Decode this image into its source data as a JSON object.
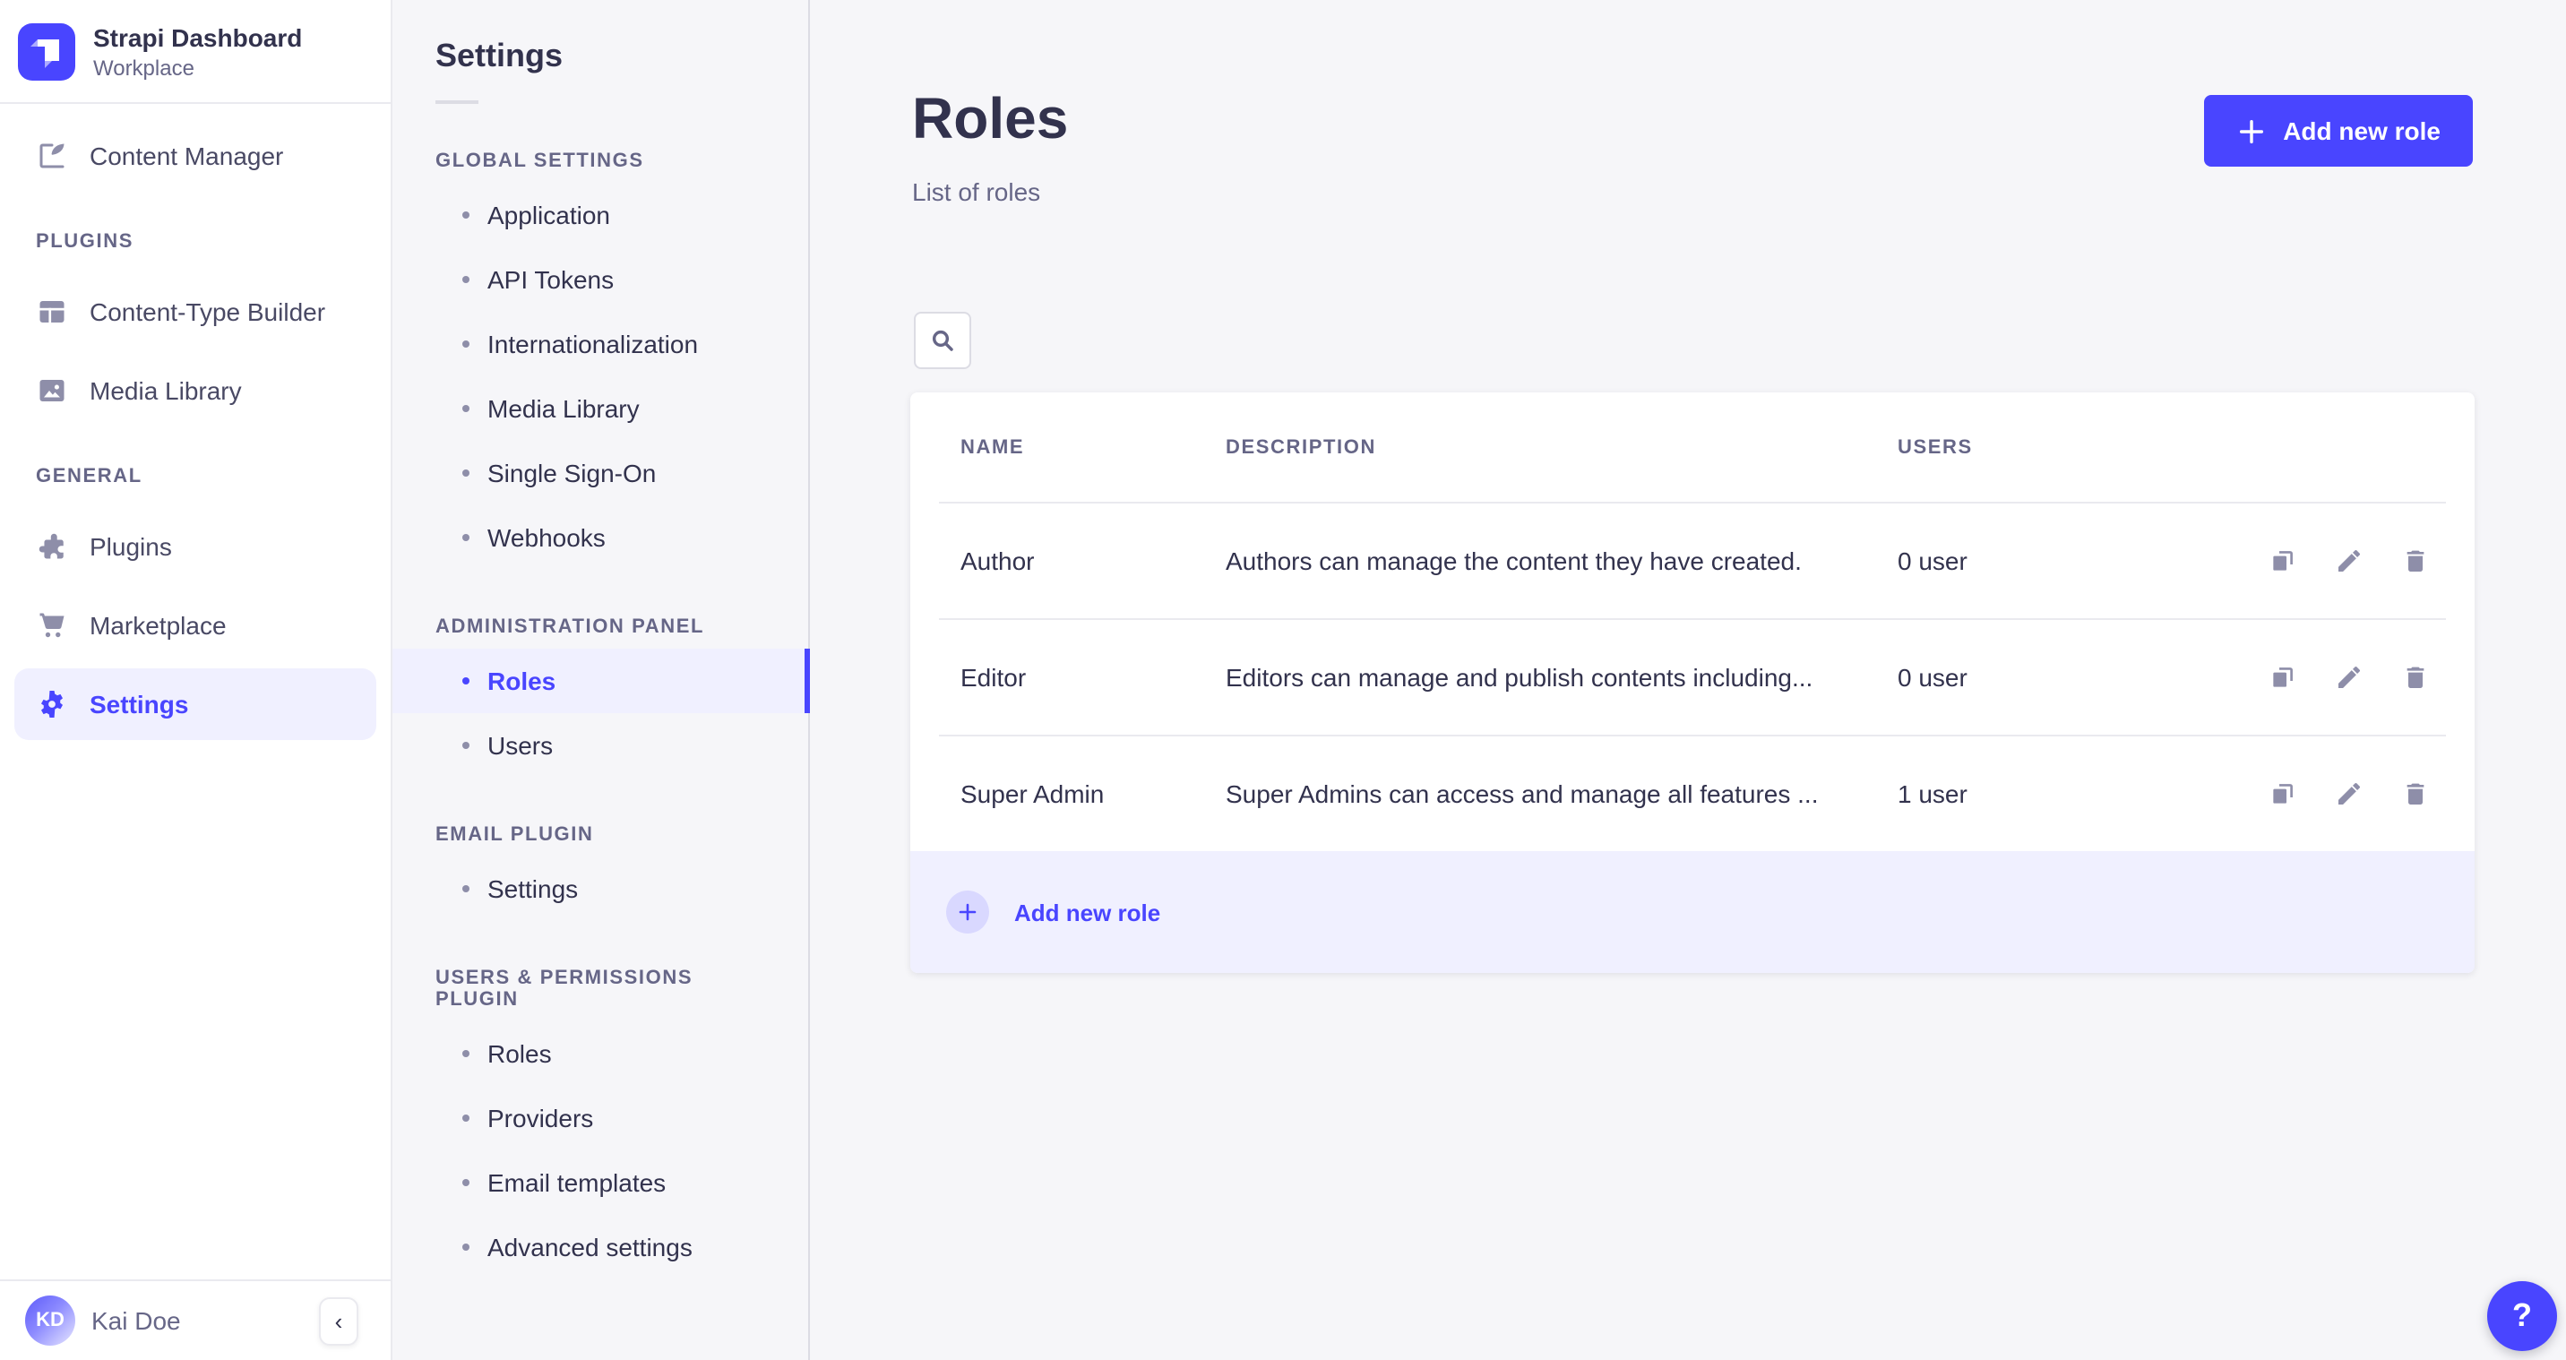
{
  "theme": {
    "colors": {
      "primary": "#4945ff",
      "primary_bg": "#f0f0ff",
      "primary_light": "#d9d8ff",
      "text": "#32324d",
      "nav_text": "#494964",
      "text_muted": "#666687",
      "icon": "#8e8ea9",
      "border": "#dcdce4",
      "divider": "#eaeaef",
      "page_bg": "#f6f6f9",
      "white": "#ffffff"
    }
  },
  "brand": {
    "title": "Strapi Dashboard",
    "subtitle": "Workplace"
  },
  "main_nav": {
    "content_manager": "Content Manager",
    "sections": [
      {
        "label": "PLUGINS",
        "items": [
          "Content-Type Builder",
          "Media Library"
        ]
      },
      {
        "label": "GENERAL",
        "items": [
          "Plugins",
          "Marketplace",
          "Settings"
        ]
      }
    ],
    "user": {
      "initials": "KD",
      "name": "Kai Doe"
    },
    "collapse_glyph": "‹"
  },
  "sub_nav": {
    "title": "Settings",
    "sections": [
      {
        "label": "GLOBAL SETTINGS",
        "items": [
          "Application",
          "API Tokens",
          "Internationalization",
          "Media Library",
          "Single Sign-On",
          "Webhooks"
        ]
      },
      {
        "label": "ADMINISTRATION PANEL",
        "items": [
          "Roles",
          "Users"
        ]
      },
      {
        "label": "EMAIL PLUGIN",
        "items": [
          "Settings"
        ]
      },
      {
        "label": "USERS & PERMISSIONS PLUGIN",
        "items": [
          "Roles",
          "Providers",
          "Email templates",
          "Advanced settings"
        ]
      }
    ]
  },
  "page": {
    "title": "Roles",
    "subtitle": "List of roles",
    "add_button": "Add new role",
    "table": {
      "headers": [
        "NAME",
        "DESCRIPTION",
        "USERS"
      ],
      "rows": [
        {
          "name": "Author",
          "description": "Authors can manage the content they have created.",
          "users": "0 user"
        },
        {
          "name": "Editor",
          "description": "Editors can manage and publish contents including...",
          "users": "0 user"
        },
        {
          "name": "Super Admin",
          "description": "Super Admins can access and manage all features ...",
          "users": "1 user"
        }
      ],
      "footer_action": "Add new role"
    },
    "help_label": "?"
  }
}
